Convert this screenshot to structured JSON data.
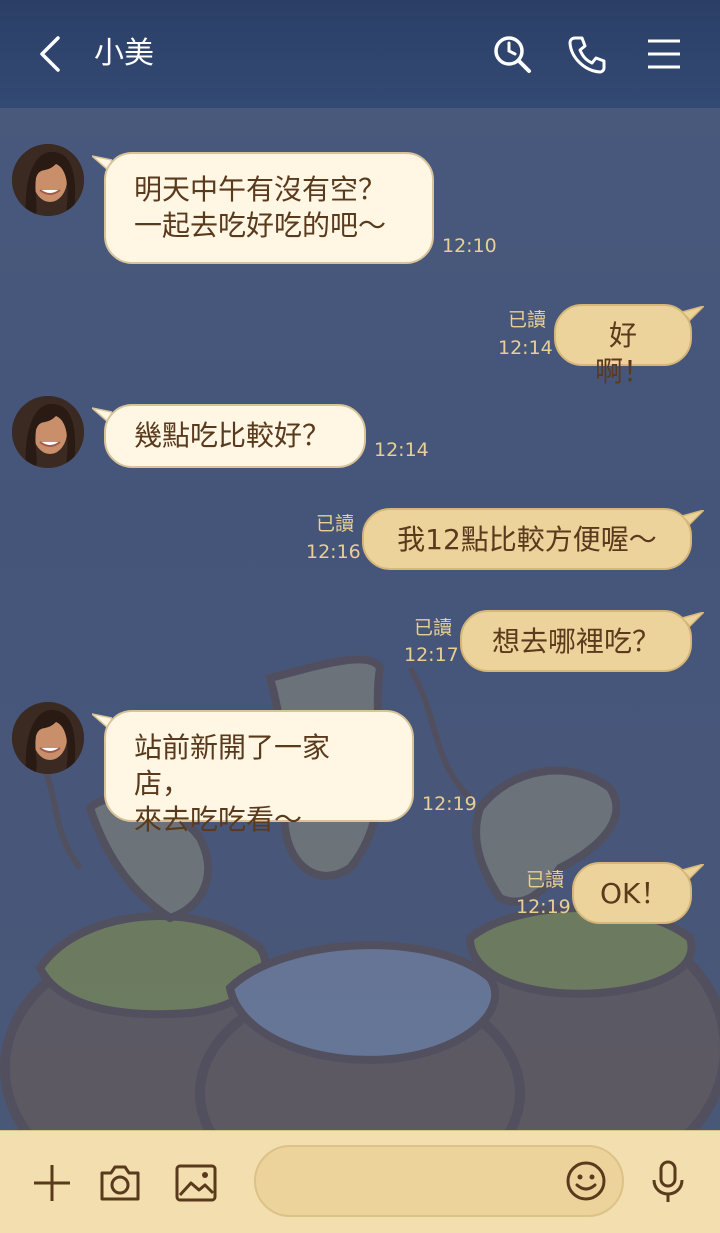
{
  "header": {
    "title": "小美",
    "icons": [
      "back-arrow-icon",
      "search-icon",
      "phone-icon",
      "menu-icon"
    ]
  },
  "messages": [
    {
      "side": "in",
      "lines": [
        "明天中午有沒有空？",
        "一起去吃好吃的吧～"
      ],
      "time": "12:10"
    },
    {
      "side": "out",
      "text": "好啊！",
      "read": "已讀",
      "time": "12:14"
    },
    {
      "side": "in",
      "lines": [
        "幾點吃比較好？"
      ],
      "time": "12:14"
    },
    {
      "side": "out",
      "text": "我12點比較方便喔～",
      "read": "已讀",
      "time": "12:16"
    },
    {
      "side": "out",
      "text": "想去哪裡吃？",
      "read": "已讀",
      "time": "12:17"
    },
    {
      "side": "in",
      "lines": [
        "站前新開了一家店，",
        "來去吃吃看～"
      ],
      "time": "12:19"
    },
    {
      "side": "out",
      "text": "OK！",
      "read": "已讀",
      "time": "12:19"
    }
  ],
  "input": {
    "placeholder": ""
  },
  "bottom_icons": [
    "plus-icon",
    "camera-icon",
    "image-icon",
    "emoji-icon",
    "microphone-icon"
  ],
  "colors": {
    "header": "#2b3f66",
    "background": "#47587a",
    "bubble_in": "#fff6e4",
    "bubble_out": "#ecd39b",
    "text": "#5a3a1c",
    "meta": "#e8cf93"
  }
}
